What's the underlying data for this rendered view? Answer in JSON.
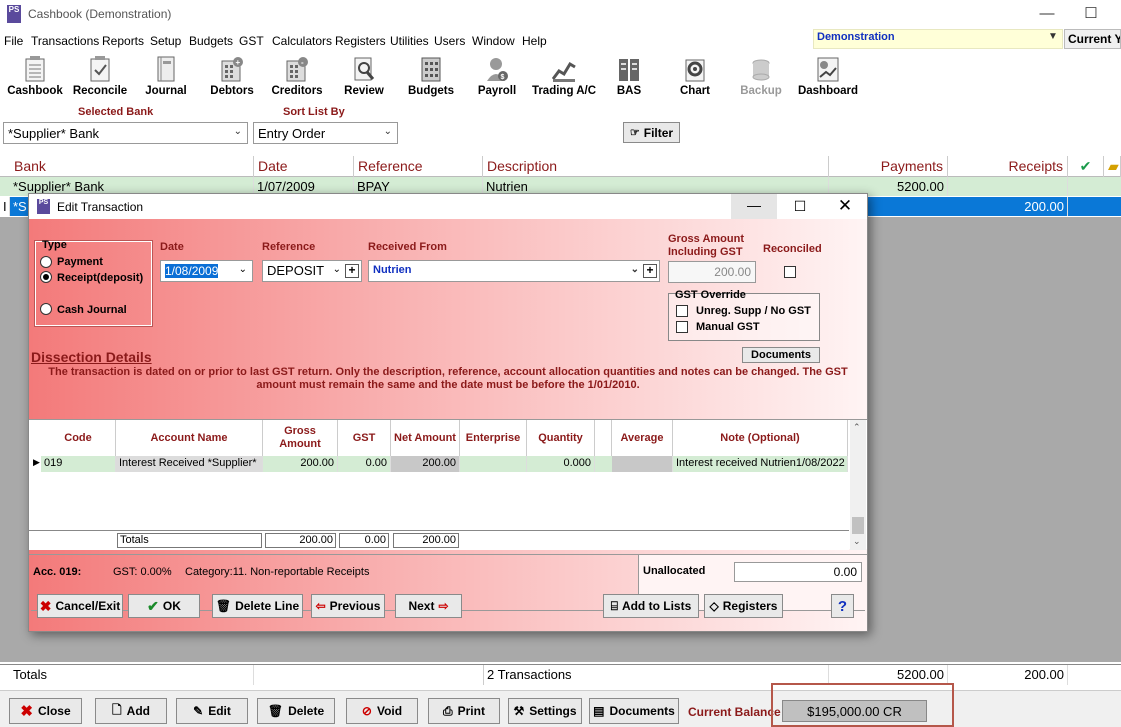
{
  "window": {
    "title": "Cashbook (Demonstration)",
    "app_icon": "PS",
    "minimize": "—",
    "maximize": "☐"
  },
  "menu": [
    "File",
    "Transactions",
    "Reports",
    "Setup",
    "Budgets",
    "GST",
    "Calculators",
    "Registers",
    "Utilities",
    "Users",
    "Window",
    "Help"
  ],
  "company": "Demonstration",
  "year_label": "Current Year",
  "toolbar": [
    "Cashbook",
    "Reconcile",
    "Journal",
    "Debtors",
    "Creditors",
    "Review",
    "Budgets",
    "Payroll",
    "Trading A/C",
    "BAS",
    "Chart",
    "Backup",
    "Dashboard"
  ],
  "filters": {
    "selected_bank_label": "Selected Bank",
    "selected_bank_value": "*Supplier* Bank",
    "sort_label": "Sort List By",
    "sort_value": "Entry Order",
    "filter_button": "Filter"
  },
  "grid": {
    "headers": {
      "bank": "Bank",
      "date": "Date",
      "reference": "Reference",
      "description": "Description",
      "payments": "Payments",
      "receipts": "Receipts"
    },
    "rows": [
      {
        "bank": "*Supplier* Bank",
        "date": "1/07/2009",
        "reference": "BPAY",
        "description": "Nutrien",
        "payments": "5200.00",
        "receipts": ""
      },
      {
        "bank": "*S",
        "date": "",
        "reference": "",
        "description": "",
        "payments": "",
        "receipts": "200.00"
      }
    ],
    "totals": {
      "label": "Totals",
      "count": "2 Transactions",
      "payments": "5200.00",
      "receipts": "200.00"
    }
  },
  "bottom": {
    "buttons": [
      "Close",
      "Add",
      "Edit",
      "Delete",
      "Void",
      "Print",
      "Settings",
      "Documents"
    ],
    "balance_label": "Current Balance",
    "balance_value": "$195,000.00 CR"
  },
  "dialog": {
    "title": "Edit Transaction",
    "type_label": "Type",
    "type_options": [
      "Payment",
      "Receipt(deposit)",
      "Cash Journal"
    ],
    "type_selected": 1,
    "date_label": "Date",
    "date_value": "1/08/2009",
    "reference_label": "Reference",
    "reference_value": "DEPOSIT",
    "received_from_label": "Received From",
    "received_from_value": "Nutrien",
    "gross_label": "Gross Amount Including GST",
    "gross_value": "200.00",
    "reconciled_label": "Reconciled",
    "gst_override_label": "GST Override",
    "gst_override_options": [
      "Unreg. Supp / No GST",
      "Manual GST"
    ],
    "documents_button": "Documents",
    "dissection_title": "Dissection Details",
    "warning": "The transaction is dated on or prior to last GST return. Only the description, reference, account allocation quantities and notes can be changed. The GST amount must remain the same and the date must be before the 1/01/2010.",
    "columns": [
      "Code",
      "Account Name",
      "Gross Amount",
      "GST",
      "Net Amount",
      "Enterprise",
      "Quantity",
      "Average",
      "Note (Optional)"
    ],
    "line": {
      "code": "019",
      "account": "Interest Received *Supplier*",
      "gross": "200.00",
      "gst": "0.00",
      "net": "200.00",
      "enterprise": "",
      "quantity": "0.000",
      "average": "",
      "note": "Interest received Nutrien1/08/2022"
    },
    "totals": {
      "label": "Totals",
      "gross": "200.00",
      "gst": "0.00",
      "net": "200.00"
    },
    "acc_info": {
      "acc": "Acc. 019:",
      "gst": "GST: 0.00%",
      "category": "Category:11. Non-reportable Receipts"
    },
    "unallocated_label": "Unallocated",
    "unallocated_value": "0.00",
    "buttons": {
      "cancel": "Cancel/Exit",
      "ok": "OK",
      "delete_line": "Delete Line",
      "previous": "Previous",
      "next": "Next",
      "add_to_lists": "Add to Lists",
      "registers": "Registers",
      "help": "?"
    }
  }
}
